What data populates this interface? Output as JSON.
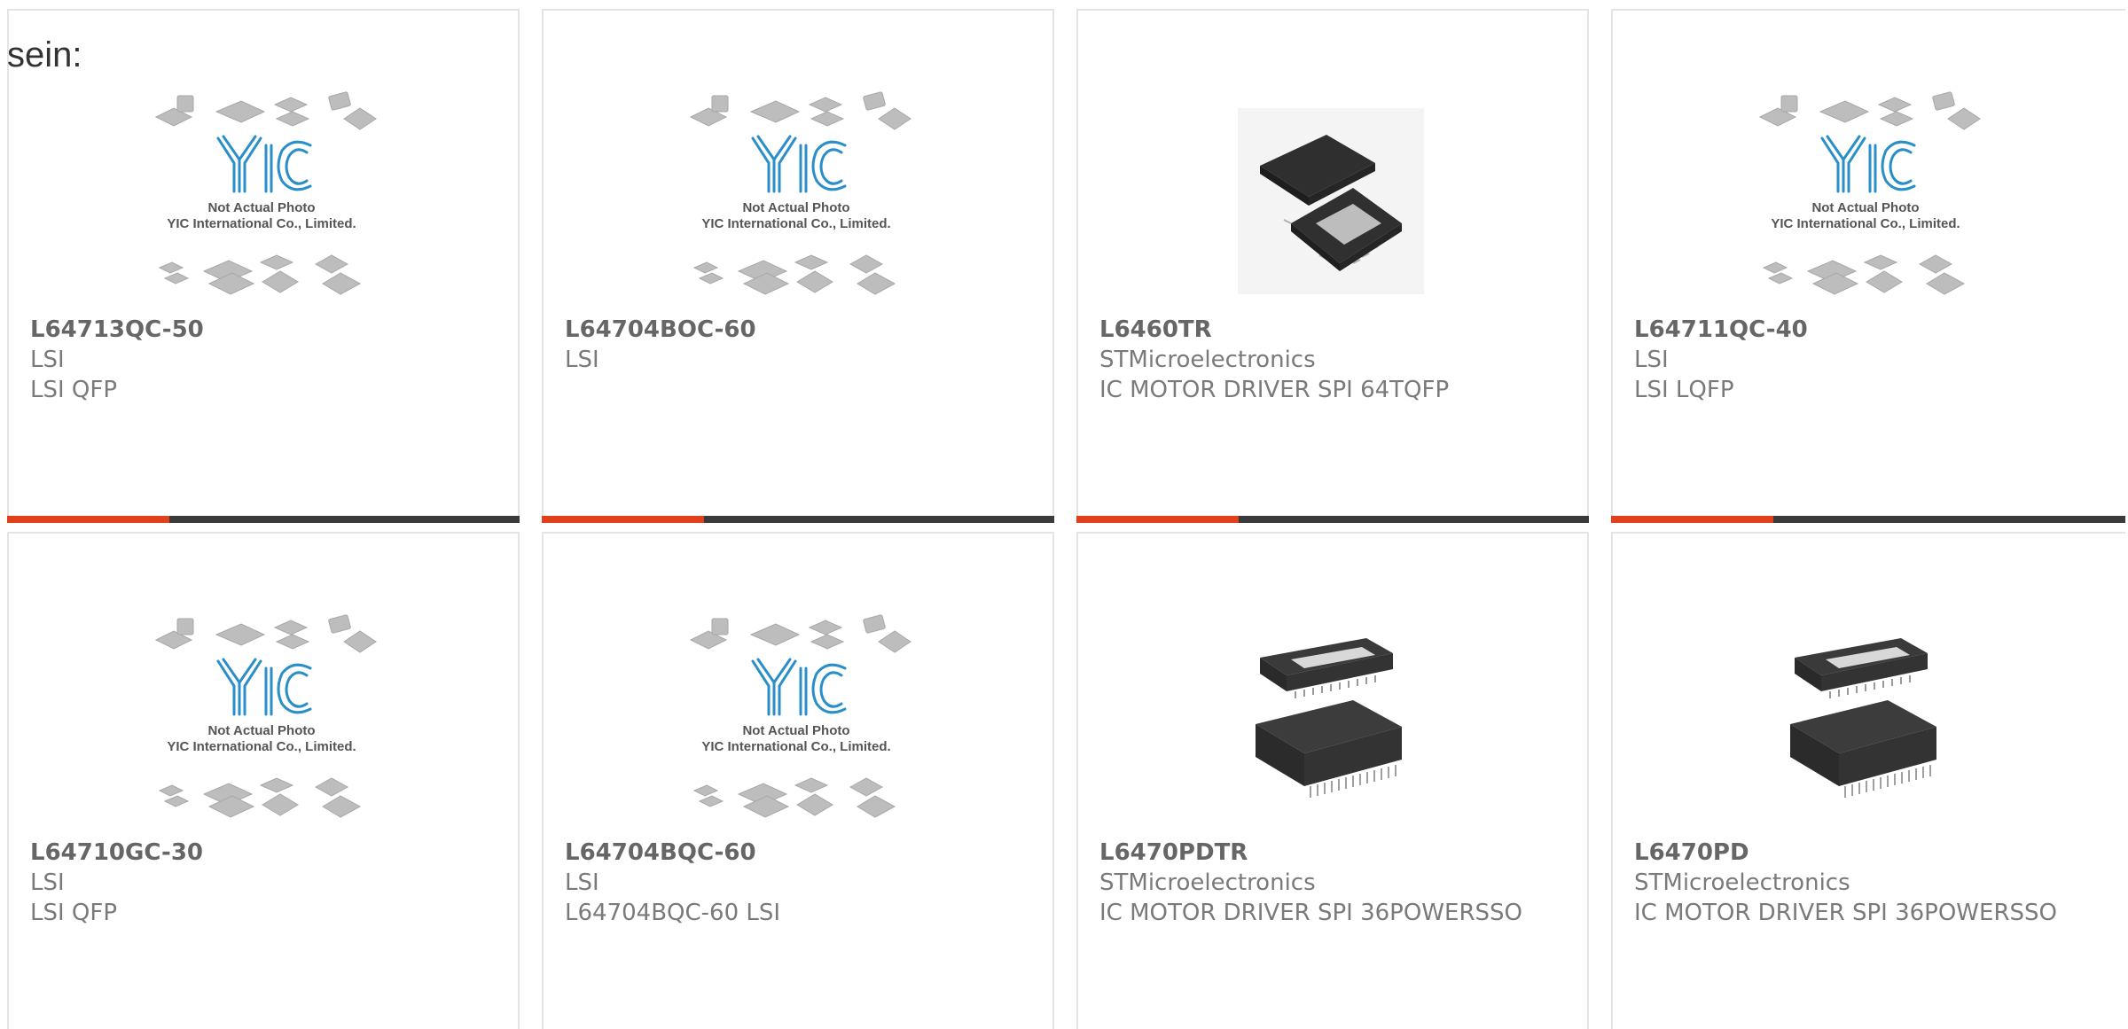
{
  "page": {
    "fragment_text": "sein:",
    "accent_color": "#e0401a",
    "bar_color": "#3a3a3a"
  },
  "placeholder_image": {
    "caption_line1": "Not Actual Photo",
    "caption_line2": "YIC International Co., Limited.",
    "logo_text": "YIC",
    "logo_color": "#2a8fc9"
  },
  "products": [
    {
      "part": "L64713QC-50",
      "maker": "LSI",
      "desc": "LSI QFP",
      "image": "yic-placeholder"
    },
    {
      "part": "L64704BOC-60",
      "maker": "LSI",
      "desc": "",
      "image": "yic-placeholder"
    },
    {
      "part": "L6460TR",
      "maker": "STMicroelectronics",
      "desc": "IC MOTOR DRIVER SPI 64TQFP",
      "image": "tqfp-chip"
    },
    {
      "part": "L64711QC-40",
      "maker": "LSI",
      "desc": "LSI LQFP",
      "image": "yic-placeholder"
    },
    {
      "part": "L64710GC-30",
      "maker": "LSI",
      "desc": "LSI QFP",
      "image": "yic-placeholder"
    },
    {
      "part": "L64704BQC-60",
      "maker": "LSI",
      "desc": "L64704BQC-60 LSI",
      "image": "yic-placeholder"
    },
    {
      "part": "L6470PDTR",
      "maker": "STMicroelectronics",
      "desc": "IC MOTOR DRIVER SPI 36POWERSSO",
      "image": "powersso-chip"
    },
    {
      "part": "L6470PD",
      "maker": "STMicroelectronics",
      "desc": "IC MOTOR DRIVER SPI 36POWERSSO",
      "image": "powersso-chip"
    }
  ]
}
